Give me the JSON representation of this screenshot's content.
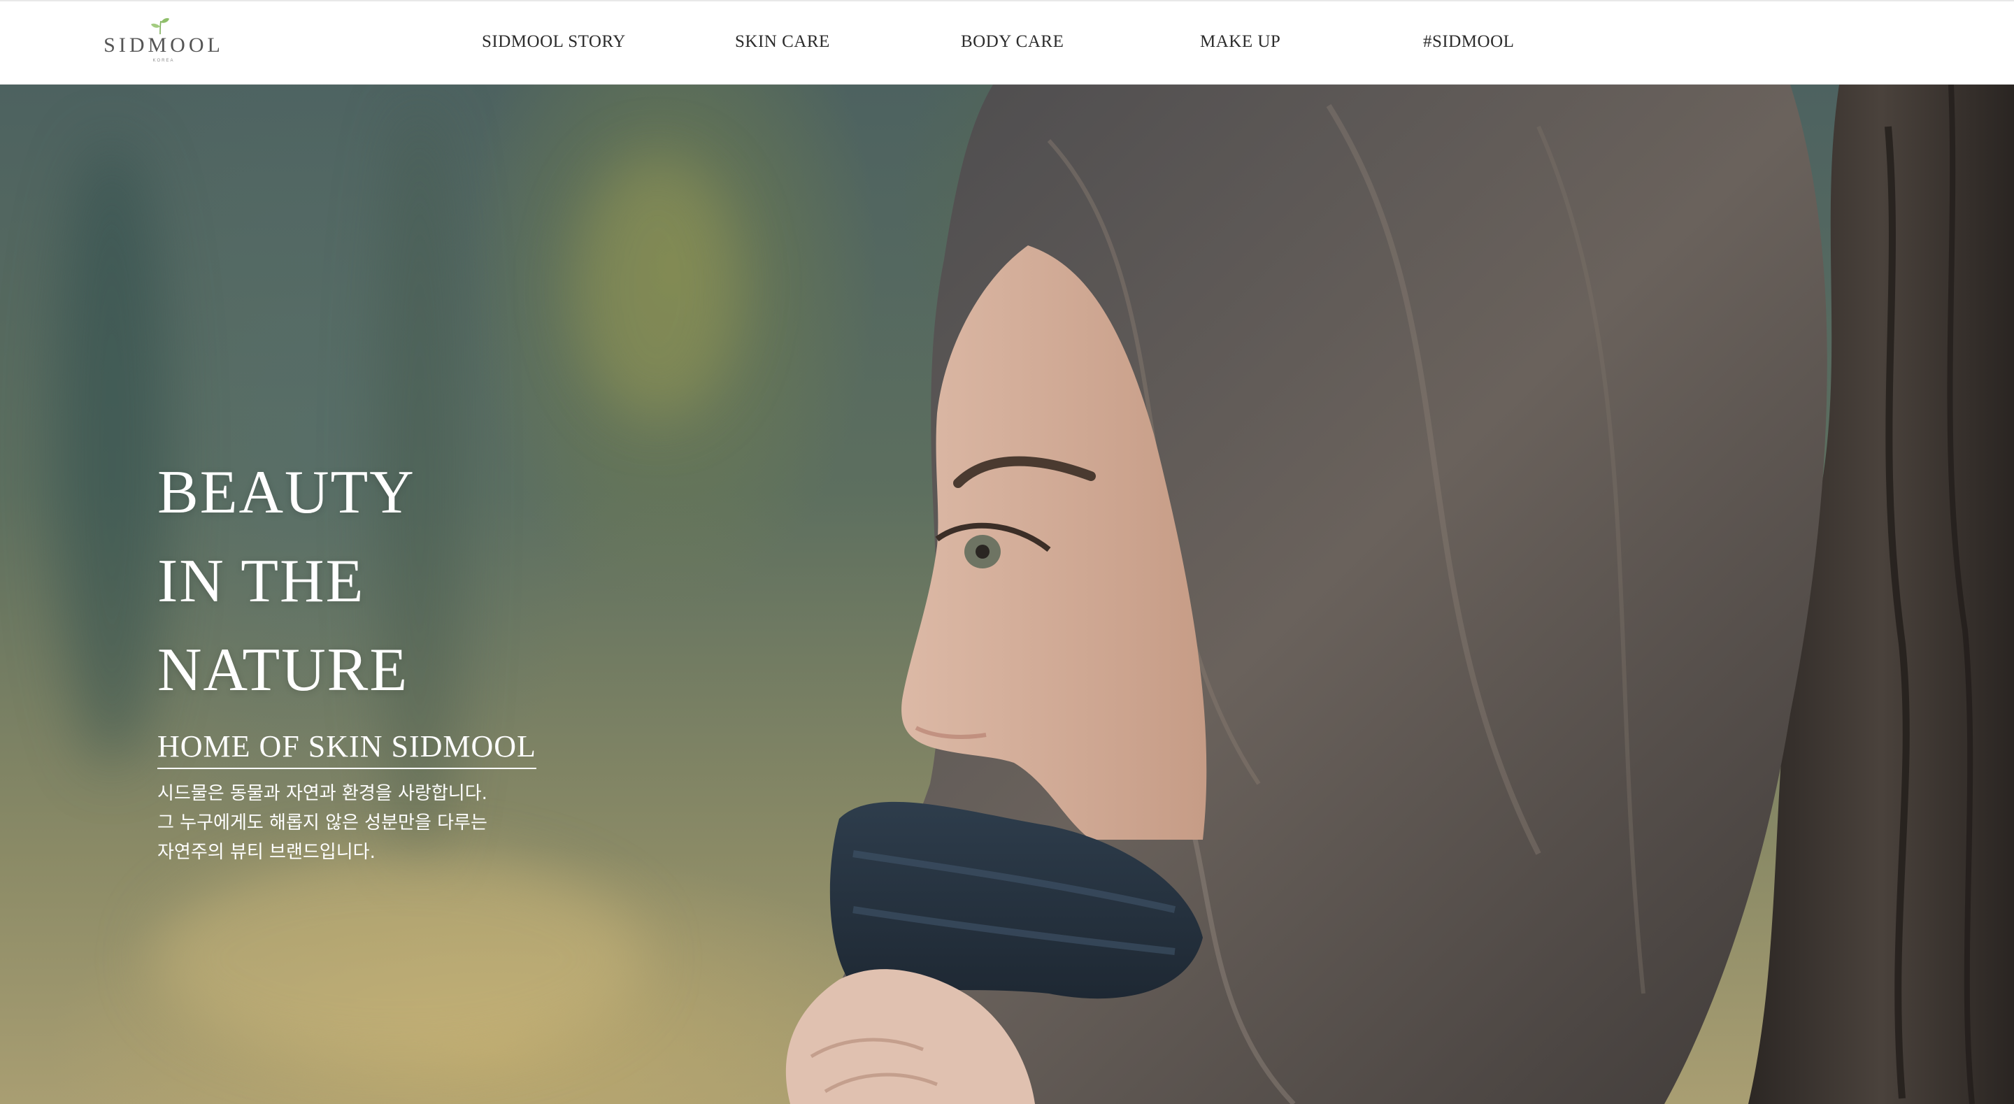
{
  "header": {
    "logo": {
      "wordmark": "SIDMOOL",
      "sub": "KOREA"
    },
    "nav": [
      {
        "label": "SIDMOOL STORY"
      },
      {
        "label": "SKIN CARE"
      },
      {
        "label": "BODY CARE"
      },
      {
        "label": "MAKE UP"
      },
      {
        "label": "#SIDMOOL"
      }
    ]
  },
  "hero": {
    "headline_lines": [
      "BEAUTY",
      "IN THE",
      "NATURE"
    ],
    "subheading": "HOME OF SKIN SIDMOOL",
    "description_lines": [
      "시드물은 동물과 자연과 환경을 사랑합니다.",
      "그 누구에게도 해롭지 않은 성분만을 다루는",
      "자연주의 뷰티 브랜드입니다."
    ]
  },
  "colors": {
    "header_bg": "#ffffff",
    "nav_text": "#2c2c2c",
    "logo_text": "#555555",
    "logo_leaf": "#8fbf6a",
    "hero_text": "#ffffff"
  }
}
